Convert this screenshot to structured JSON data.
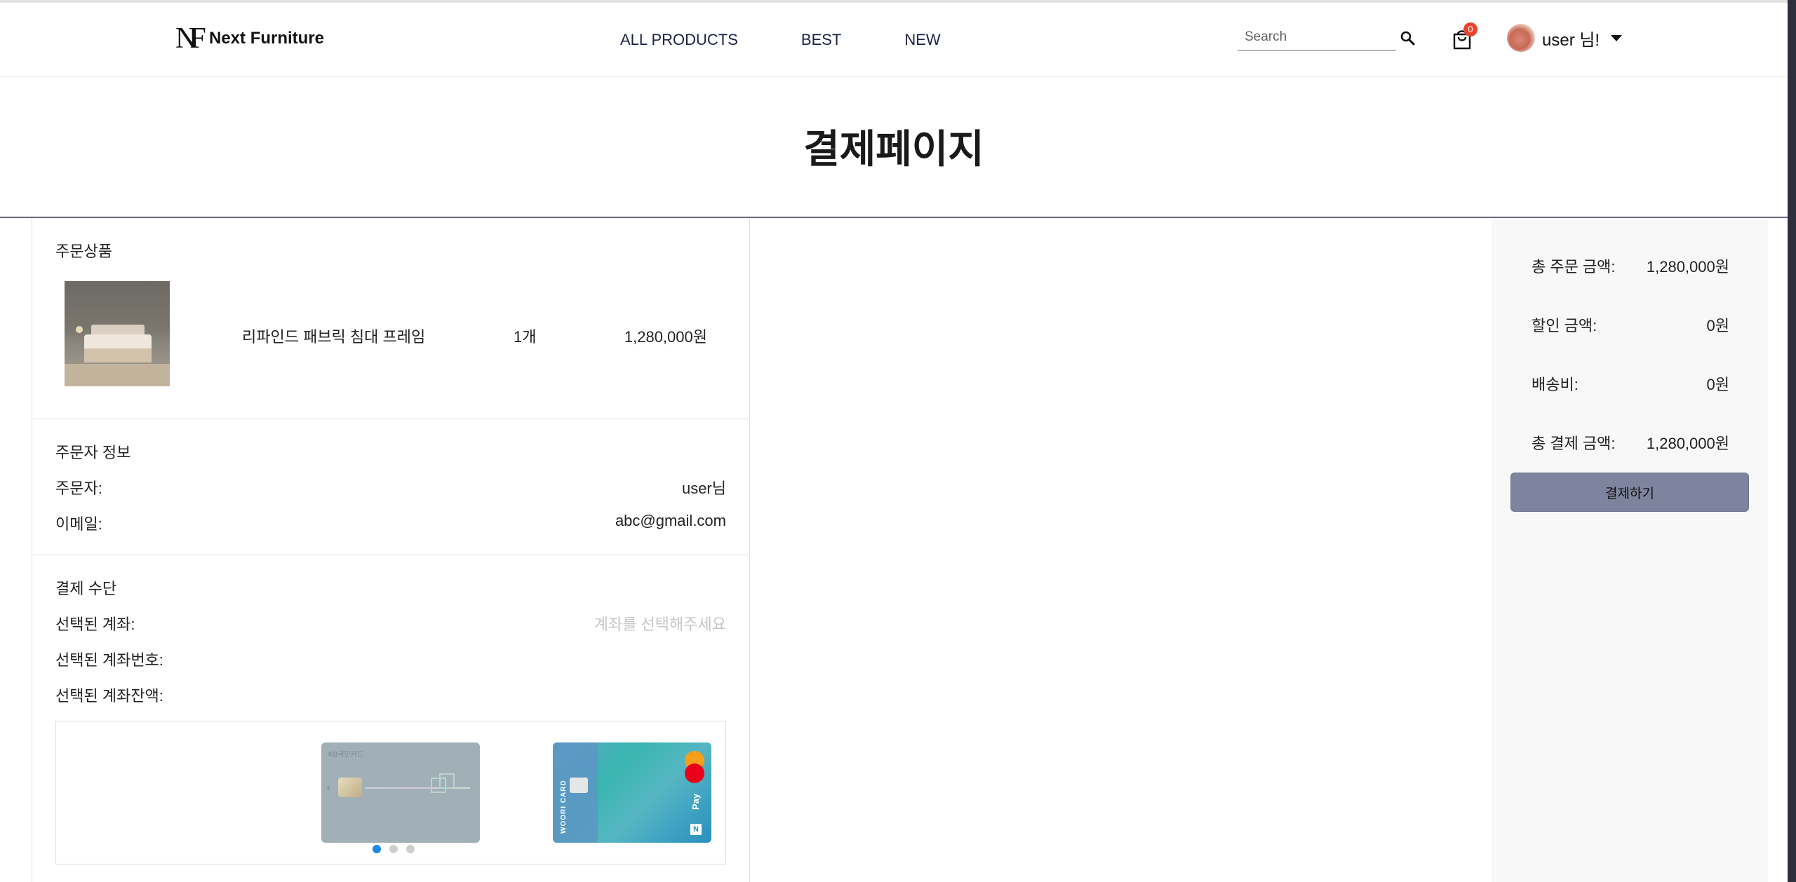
{
  "header": {
    "logo_mark": "NF",
    "brand": "Next Furniture",
    "nav": [
      "ALL PRODUCTS",
      "BEST",
      "NEW"
    ],
    "search_placeholder": "Search",
    "cart_count": "0",
    "user_label": "user 님!"
  },
  "page": {
    "title": "결제페이지"
  },
  "order_items": {
    "section_title": "주문상품",
    "item": {
      "name": "리파인드 패브릭 침대 프레임",
      "quantity": "1개",
      "price": "1,280,000원"
    }
  },
  "orderer": {
    "section_title": "주문자 정보",
    "name_label": "주문자:",
    "name_value": "user님",
    "email_label": "이메일:",
    "email_value": "abc@gmail.com"
  },
  "payment": {
    "section_title": "결제 수단",
    "account_label": "선택된 계좌:",
    "account_value": "계좌를 선택해주세요",
    "account_number_label": "선택된 계좌번호:",
    "account_balance_label": "선택된 계좌잔액:",
    "cards": [
      {
        "brand": "KB국민카드"
      },
      {
        "brand": "WOORI CARD",
        "pay": "Pay"
      }
    ],
    "carousel_active_index": 0,
    "carousel_count": 3
  },
  "summary": {
    "total_order_label": "총 주문 금액:",
    "total_order_value": "1,280,000원",
    "discount_label": "할인 금액:",
    "discount_value": "0원",
    "shipping_label": "배송비:",
    "shipping_value": "0원",
    "total_payment_label": "총 결제 금액:",
    "total_payment_value": "1,280,000원",
    "pay_button": "결제하기"
  },
  "colors": {
    "nav_text": "#1d2244",
    "cart_badge": "#e8442e",
    "pay_button": "#7f849e",
    "carousel_active": "#1e88e5"
  }
}
